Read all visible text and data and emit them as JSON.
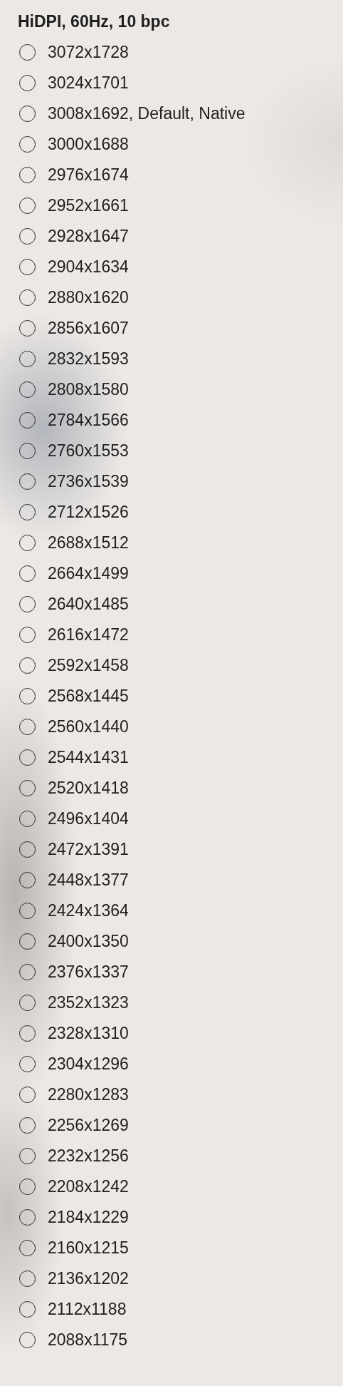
{
  "heading": "HiDPI, 60Hz, 10 bpc",
  "resolutions": [
    {
      "label": "3072x1728",
      "selected": false
    },
    {
      "label": "3024x1701",
      "selected": false
    },
    {
      "label": "3008x1692, Default, Native",
      "selected": false
    },
    {
      "label": "3000x1688",
      "selected": false
    },
    {
      "label": "2976x1674",
      "selected": false
    },
    {
      "label": "2952x1661",
      "selected": false
    },
    {
      "label": "2928x1647",
      "selected": false
    },
    {
      "label": "2904x1634",
      "selected": false
    },
    {
      "label": "2880x1620",
      "selected": false
    },
    {
      "label": "2856x1607",
      "selected": false
    },
    {
      "label": "2832x1593",
      "selected": false
    },
    {
      "label": "2808x1580",
      "selected": false
    },
    {
      "label": "2784x1566",
      "selected": false
    },
    {
      "label": "2760x1553",
      "selected": false
    },
    {
      "label": "2736x1539",
      "selected": false
    },
    {
      "label": "2712x1526",
      "selected": false
    },
    {
      "label": "2688x1512",
      "selected": false
    },
    {
      "label": "2664x1499",
      "selected": false
    },
    {
      "label": "2640x1485",
      "selected": false
    },
    {
      "label": "2616x1472",
      "selected": false
    },
    {
      "label": "2592x1458",
      "selected": false
    },
    {
      "label": "2568x1445",
      "selected": false
    },
    {
      "label": "2560x1440",
      "selected": false
    },
    {
      "label": "2544x1431",
      "selected": false
    },
    {
      "label": "2520x1418",
      "selected": false
    },
    {
      "label": "2496x1404",
      "selected": false
    },
    {
      "label": "2472x1391",
      "selected": false
    },
    {
      "label": "2448x1377",
      "selected": false
    },
    {
      "label": "2424x1364",
      "selected": false
    },
    {
      "label": "2400x1350",
      "selected": false
    },
    {
      "label": "2376x1337",
      "selected": false
    },
    {
      "label": "2352x1323",
      "selected": false
    },
    {
      "label": "2328x1310",
      "selected": false
    },
    {
      "label": "2304x1296",
      "selected": false
    },
    {
      "label": "2280x1283",
      "selected": false
    },
    {
      "label": "2256x1269",
      "selected": false
    },
    {
      "label": "2232x1256",
      "selected": false
    },
    {
      "label": "2208x1242",
      "selected": false
    },
    {
      "label": "2184x1229",
      "selected": false
    },
    {
      "label": "2160x1215",
      "selected": false
    },
    {
      "label": "2136x1202",
      "selected": false
    },
    {
      "label": "2112x1188",
      "selected": false
    },
    {
      "label": "2088x1175",
      "selected": false
    }
  ]
}
